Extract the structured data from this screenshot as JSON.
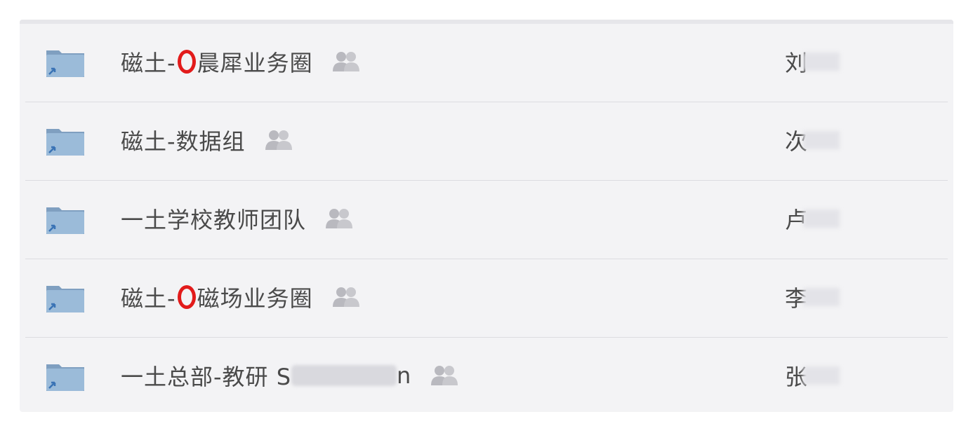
{
  "folders": [
    {
      "name_prefix": "磁土-",
      "name_suffix": "晨犀业务圈",
      "owner": "刘",
      "redacted_name": false,
      "circle_mark": true,
      "folder_icon": "shared-folder-icon",
      "group_icon": "group-users-icon"
    },
    {
      "name_prefix": "磁土-数据组",
      "name_suffix": "",
      "owner": "次",
      "redacted_name": false,
      "circle_mark": false,
      "folder_icon": "shared-folder-icon",
      "group_icon": "group-users-icon"
    },
    {
      "name_prefix": "一土学校教师团队",
      "name_suffix": "",
      "owner": "卢",
      "redacted_name": false,
      "circle_mark": false,
      "folder_icon": "shared-folder-icon",
      "group_icon": "group-users-icon"
    },
    {
      "name_prefix": "磁土-",
      "name_suffix": "磁场业务圈",
      "owner": "李",
      "redacted_name": false,
      "circle_mark": true,
      "folder_icon": "shared-folder-icon",
      "group_icon": "group-users-icon"
    },
    {
      "name_prefix": "一土总部-教研 S",
      "name_suffix": "n",
      "owner": "张",
      "redacted_name": true,
      "circle_mark": false,
      "folder_icon": "shared-folder-icon",
      "group_icon": "group-users-icon"
    }
  ],
  "colors": {
    "folder": "#8fb0cf",
    "text": "#4a4a4a",
    "mark": "#e21b1b",
    "group_icon": "#b9b9bf"
  }
}
